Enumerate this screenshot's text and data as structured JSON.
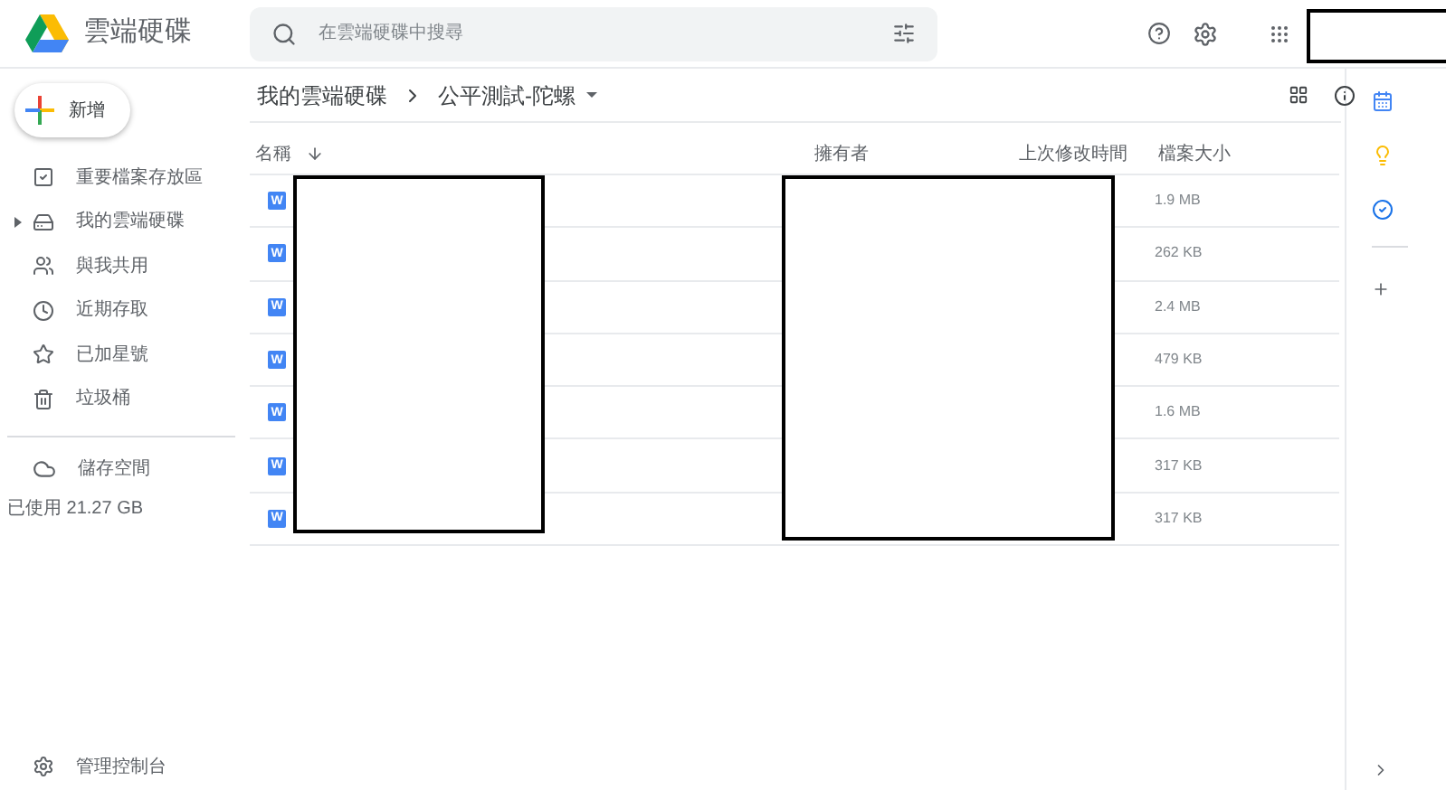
{
  "app": {
    "title": "雲端硬碟"
  },
  "search": {
    "placeholder": "在雲端硬碟中搜尋"
  },
  "new_button": {
    "label": "新增"
  },
  "sidebar": {
    "items": [
      {
        "label": "重要檔案存放區",
        "selected": false,
        "expandable": false
      },
      {
        "label": "我的雲端硬碟",
        "selected": false,
        "expandable": true
      },
      {
        "label": "與我共用",
        "selected": false,
        "expandable": false
      },
      {
        "label": "近期存取",
        "selected": false,
        "expandable": false
      },
      {
        "label": "已加星號",
        "selected": false,
        "expandable": false
      },
      {
        "label": "垃圾桶",
        "selected": false,
        "expandable": false
      }
    ],
    "storage": {
      "label": "儲存空間",
      "usage": "已使用 21.27 GB"
    },
    "admin": {
      "label": "管理控制台"
    }
  },
  "breadcrumb": [
    {
      "label": "我的雲端硬碟"
    },
    {
      "label": "公平測試-陀螺"
    }
  ],
  "table": {
    "columns": [
      {
        "label": "名稱",
        "sorted": true
      },
      {
        "label": "擁有者"
      },
      {
        "label": "上次修改時間"
      },
      {
        "label": "檔案大小"
      }
    ],
    "rows": [
      {
        "icon": "W",
        "size": "1.9 MB"
      },
      {
        "icon": "W",
        "size": "262 KB"
      },
      {
        "icon": "W",
        "size": "2.4 MB"
      },
      {
        "icon": "W",
        "size": "479 KB"
      },
      {
        "icon": "W",
        "size": "1.6 MB"
      },
      {
        "icon": "W",
        "size": "317 KB"
      },
      {
        "icon": "W",
        "size": "317 KB"
      }
    ]
  }
}
